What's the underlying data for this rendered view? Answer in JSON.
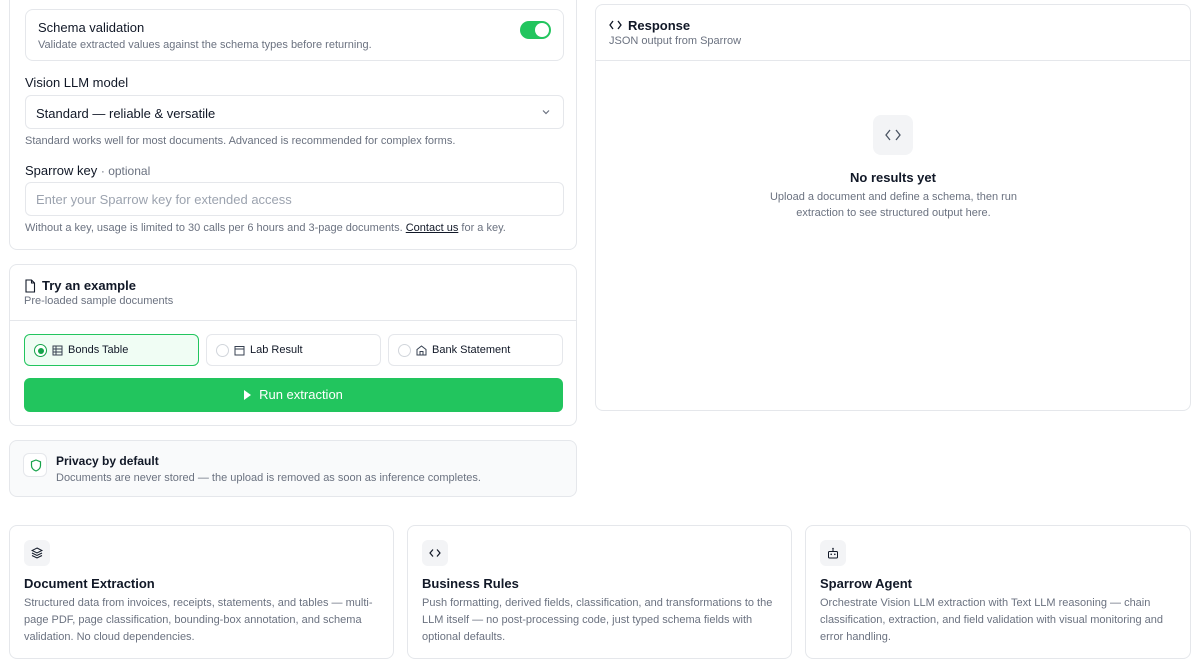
{
  "config": {
    "schema_title": "Schema validation",
    "schema_sub": "Validate extracted values against the schema types before returning.",
    "schema_enabled": true,
    "model_label": "Vision LLM model",
    "model_value": "Standard — reliable & versatile",
    "model_helper": "Standard works well for most documents. Advanced is recommended for complex forms.",
    "key_label": "Sparrow key",
    "key_optional": "· optional",
    "key_placeholder": "Enter your Sparrow key for extended access",
    "key_helper_pre": "Without a key, usage is limited to 30 calls per 6 hours and 3-page documents.",
    "key_helper_link": "Contact us",
    "key_helper_post": "for a key."
  },
  "examples": {
    "title": "Try an example",
    "sub": "Pre-loaded sample documents",
    "options": [
      {
        "label": "Bonds Table",
        "selected": true
      },
      {
        "label": "Lab Result",
        "selected": false
      },
      {
        "label": "Bank Statement",
        "selected": false
      }
    ],
    "run_label": "Run extraction"
  },
  "privacy": {
    "title": "Privacy by default",
    "sub": "Documents are never stored — the upload is removed as soon as inference completes."
  },
  "response": {
    "title": "Response",
    "sub": "JSON output from Sparrow",
    "empty_title": "No results yet",
    "empty_sub": "Upload a document and define a schema, then run extraction to see structured output here."
  },
  "features": [
    {
      "title": "Document Extraction",
      "desc": "Structured data from invoices, receipts, statements, and tables — multi-page PDF, page classification, bounding-box annotation, and schema validation. No cloud dependencies.",
      "icon": "layers-icon"
    },
    {
      "title": "Business Rules",
      "desc": "Push formatting, derived fields, classification, and transformations to the LLM itself — no post-processing code, just typed schema fields with optional defaults.",
      "icon": "code-icon"
    },
    {
      "title": "Sparrow Agent",
      "desc": "Orchestrate Vision LLM extraction with Text LLM reasoning — chain classification, extraction, and field validation with visual monitoring and error handling.",
      "icon": "robot-icon"
    }
  ],
  "colors": {
    "accent": "#22c55e",
    "border": "#e5e7eb"
  }
}
